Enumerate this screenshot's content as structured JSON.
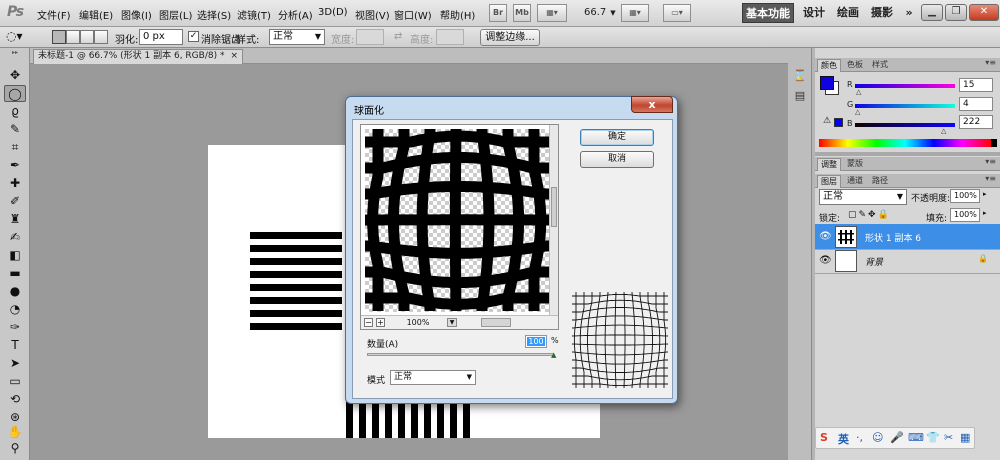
{
  "app": {
    "logo": "Ps"
  },
  "menu": [
    "文件(F)",
    "编辑(E)",
    "图像(I)",
    "图层(L)",
    "选择(S)",
    "滤镜(T)",
    "分析(A)",
    "3D(D)",
    "视图(V)",
    "窗口(W)",
    "帮助(H)"
  ],
  "app_buttons": {
    "bridge": "Br",
    "mini_bridge": "Mb"
  },
  "zoom_level": "66.7",
  "workspaces": {
    "essentials": "基本功能",
    "design": "设计",
    "painting": "绘画",
    "photography": "摄影",
    "more": "»"
  },
  "options_bar": {
    "feather_label": "羽化:",
    "feather_value": "0 px",
    "antialias_label": "消除锯齿",
    "style_label": "样式:",
    "style_value": "正常",
    "width_label": "宽度:",
    "height_label": "高度:",
    "refine_edge": "调整边缘..."
  },
  "document_tab": {
    "title": "未标题-1 @ 66.7% (形状 1 副本 6, RGB/8) *",
    "close": "×"
  },
  "color_panel": {
    "tabs": [
      "颜色",
      "色板",
      "样式"
    ],
    "channels": [
      {
        "label": "R",
        "value": "15"
      },
      {
        "label": "G",
        "value": "4"
      },
      {
        "label": "B",
        "value": "222"
      }
    ],
    "foreground": "#0f04de",
    "background": "#ffffff"
  },
  "adjust_panel": {
    "tabs": [
      "调整",
      "蒙版"
    ]
  },
  "layers_panel": {
    "tabs": [
      "图层",
      "通道",
      "路径"
    ],
    "blend_mode": "正常",
    "opacity_label": "不透明度:",
    "opacity_value": "100%",
    "lock_label": "锁定:",
    "fill_label": "填充:",
    "fill_value": "100%",
    "layers": [
      {
        "name": "形状 1 副本 6",
        "selected": true
      },
      {
        "name": "背景",
        "selected": false
      }
    ]
  },
  "dialog": {
    "title": "球面化",
    "close": "x",
    "ok": "确定",
    "cancel": "取消",
    "preview_zoom": "100%",
    "amount_label": "数量(A)",
    "amount_value": "100",
    "amount_unit": "%",
    "amount_level": 1.0,
    "mode_label": "模式",
    "mode_value": "正常"
  },
  "ime_bar": {
    "logo": "S",
    "lang": "英"
  },
  "colors": {
    "selected_layer": "#3c8ee6",
    "dialog_frame": "#c7dbf0",
    "canvas_bg": "#9a9a9a"
  }
}
